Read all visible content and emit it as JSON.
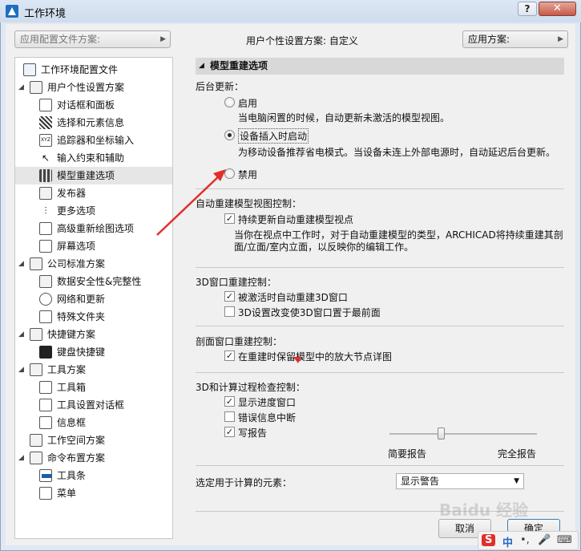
{
  "window": {
    "title": "工作环境"
  },
  "titlebar": {
    "help_label": "?",
    "close_label": "✕"
  },
  "top": {
    "profile_combo": "应用配置文件方案:",
    "user_profile_text": "用户个性设置方案:  自定义",
    "apply_scheme_label": "应用方案:"
  },
  "tree": {
    "items": [
      {
        "label": "工作环境配置文件",
        "icon": "profile-icon"
      },
      {
        "label": "用户个性设置方案",
        "icon": "user-scheme-icon"
      },
      {
        "label": "对话框和面板",
        "icon": "dialog-icon"
      },
      {
        "label": "选择和元素信息",
        "icon": "selection-icon"
      },
      {
        "label": "追踪器和坐标输入",
        "icon": "tracker-icon"
      },
      {
        "label": "输入约束和辅助",
        "icon": "constraint-icon"
      },
      {
        "label": "模型重建选项",
        "icon": "rebuild-icon"
      },
      {
        "label": "发布器",
        "icon": "publisher-icon"
      },
      {
        "label": "更多选项",
        "icon": "more-options-icon"
      },
      {
        "label": "高级重新绘图选项",
        "icon": "redraw-icon"
      },
      {
        "label": "屏幕选项",
        "icon": "screen-icon"
      },
      {
        "label": "公司标准方案",
        "icon": "company-scheme-icon"
      },
      {
        "label": "数据安全性&完整性",
        "icon": "data-safety-icon"
      },
      {
        "label": "网络和更新",
        "icon": "network-icon"
      },
      {
        "label": "特殊文件夹",
        "icon": "folder-icon"
      },
      {
        "label": "快捷键方案",
        "icon": "shortcut-scheme-icon"
      },
      {
        "label": "键盘快捷键",
        "icon": "keyboard-icon"
      },
      {
        "label": "工具方案",
        "icon": "tool-scheme-icon"
      },
      {
        "label": "工具箱",
        "icon": "toolbox-icon"
      },
      {
        "label": "工具设置对话框",
        "icon": "tool-settings-icon"
      },
      {
        "label": "信息框",
        "icon": "info-box-icon"
      },
      {
        "label": "工作空间方案",
        "icon": "workspace-icon"
      },
      {
        "label": "命令布置方案",
        "icon": "command-layout-icon"
      },
      {
        "label": "工具条",
        "icon": "toolbar-icon"
      },
      {
        "label": "菜单",
        "icon": "menu-icon"
      }
    ]
  },
  "panel": {
    "header": "模型重建选项",
    "background_update": "后台更新：",
    "opt_enable": "启用",
    "opt_enable_desc": "当电脑闲置的时候，自动更新未激活的模型视图。",
    "opt_plugged": "设备插入时启动",
    "opt_plugged_desc": "为移动设备推荐省电模式。当设备未连上外部电源时，自动延迟后台更新。",
    "opt_disable": "禁用",
    "auto_rebuild_title": "自动重建模型视图控制：",
    "auto_rebuild_check": "持续更新自动重建模型视点",
    "auto_rebuild_desc1": "当你在视点中工作时，对于自动重建模型的类型，ARCHICAD将持续重建其剖",
    "auto_rebuild_desc2": "面/立面/室内立面，以反映你的编辑工作。",
    "w3d_title": "3D窗口重建控制：",
    "w3d_check1": "被激活时自动重建3D窗口",
    "w3d_check2": "3D设置改变使3D窗口置于最前面",
    "section_title": "剖面窗口重建控制：",
    "section_check": "在重建时保留模型中的放大节点详图",
    "calc_title": "3D和计算过程检查控制：",
    "calc_check1": "显示进度窗口",
    "calc_check2": "错误信息中断",
    "calc_check3": "写报告",
    "slider_left": "简要报告",
    "slider_right": "完全报告",
    "elements_label": "选定用于计算的元素：",
    "elements_value": "显示警告"
  },
  "buttons": {
    "cancel": "取消",
    "ok": "确定"
  },
  "overlay": {
    "watermark": "Baidu 经验",
    "ime": [
      "S",
      "中",
      "•,",
      "🎤",
      "⌨"
    ]
  },
  "colors": {
    "arrow": "#e0302a",
    "selection": "#e6e6e6",
    "ok_border": "#3c7fb1"
  }
}
